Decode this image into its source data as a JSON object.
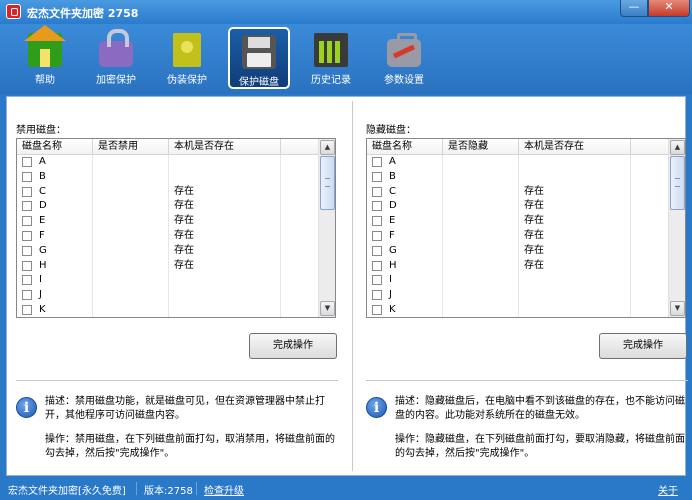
{
  "window": {
    "title": "宏杰文件夹加密  2758",
    "minimize": "—",
    "close": "✕"
  },
  "toolbar": {
    "items": [
      {
        "label": "帮助",
        "icon": "help-house-icon"
      },
      {
        "label": "加密保护",
        "icon": "lock-icon"
      },
      {
        "label": "伪装保护",
        "icon": "disguise-book-icon"
      },
      {
        "label": "保护磁盘",
        "icon": "disk-icon",
        "active": true
      },
      {
        "label": "历史记录",
        "icon": "history-chart-icon"
      },
      {
        "label": "参数设置",
        "icon": "settings-toolbox-icon"
      }
    ]
  },
  "left_panel": {
    "title": "禁用磁盘：",
    "columns": [
      "磁盘名称",
      "是否禁用",
      "本机是否存在"
    ],
    "rows": [
      {
        "drive": "A",
        "disabled": "",
        "exists": ""
      },
      {
        "drive": "B",
        "disabled": "",
        "exists": ""
      },
      {
        "drive": "C",
        "disabled": "",
        "exists": "存在"
      },
      {
        "drive": "D",
        "disabled": "",
        "exists": "存在"
      },
      {
        "drive": "E",
        "disabled": "",
        "exists": "存在"
      },
      {
        "drive": "F",
        "disabled": "",
        "exists": "存在"
      },
      {
        "drive": "G",
        "disabled": "",
        "exists": "存在"
      },
      {
        "drive": "H",
        "disabled": "",
        "exists": "存在"
      },
      {
        "drive": "I",
        "disabled": "",
        "exists": ""
      },
      {
        "drive": "J",
        "disabled": "",
        "exists": ""
      },
      {
        "drive": "K",
        "disabled": "",
        "exists": ""
      }
    ],
    "button": "完成操作",
    "desc1": "描述：禁用磁盘功能，就是磁盘可见，但在资源管理器中禁止打开，其他程序可访问磁盘内容。",
    "desc2": "操作：禁用磁盘，在下列磁盘前面打勾，取消禁用，将磁盘前面的勾去掉，然后按\"完成操作\"。"
  },
  "right_panel": {
    "title": "隐藏磁盘：",
    "columns": [
      "磁盘名称",
      "是否隐藏",
      "本机是否存在"
    ],
    "rows": [
      {
        "drive": "A",
        "hidden": "",
        "exists": ""
      },
      {
        "drive": "B",
        "hidden": "",
        "exists": ""
      },
      {
        "drive": "C",
        "hidden": "",
        "exists": "存在"
      },
      {
        "drive": "D",
        "hidden": "",
        "exists": "存在"
      },
      {
        "drive": "E",
        "hidden": "",
        "exists": "存在"
      },
      {
        "drive": "F",
        "hidden": "",
        "exists": "存在"
      },
      {
        "drive": "G",
        "hidden": "",
        "exists": "存在"
      },
      {
        "drive": "H",
        "hidden": "",
        "exists": "存在"
      },
      {
        "drive": "I",
        "hidden": "",
        "exists": ""
      },
      {
        "drive": "J",
        "hidden": "",
        "exists": ""
      },
      {
        "drive": "K",
        "hidden": "",
        "exists": ""
      }
    ],
    "button": "完成操作",
    "desc1": "描述：隐藏磁盘后，在电脑中看不到该磁盘的存在，也不能访问磁盘的内容。此功能对系统所在的磁盘无效。",
    "desc2": "操作：隐藏磁盘，在下列磁盘前面打勾，要取消隐藏，将磁盘前面的勾去掉，然后按\"完成操作\"。"
  },
  "statusbar": {
    "app": "宏杰文件夹加密[永久免费]",
    "version": "版本:2758",
    "upgrade": "检查升级",
    "about": "关于"
  },
  "colors": {
    "frame": "#2a79c8",
    "active_tool": "#0f3d78"
  }
}
